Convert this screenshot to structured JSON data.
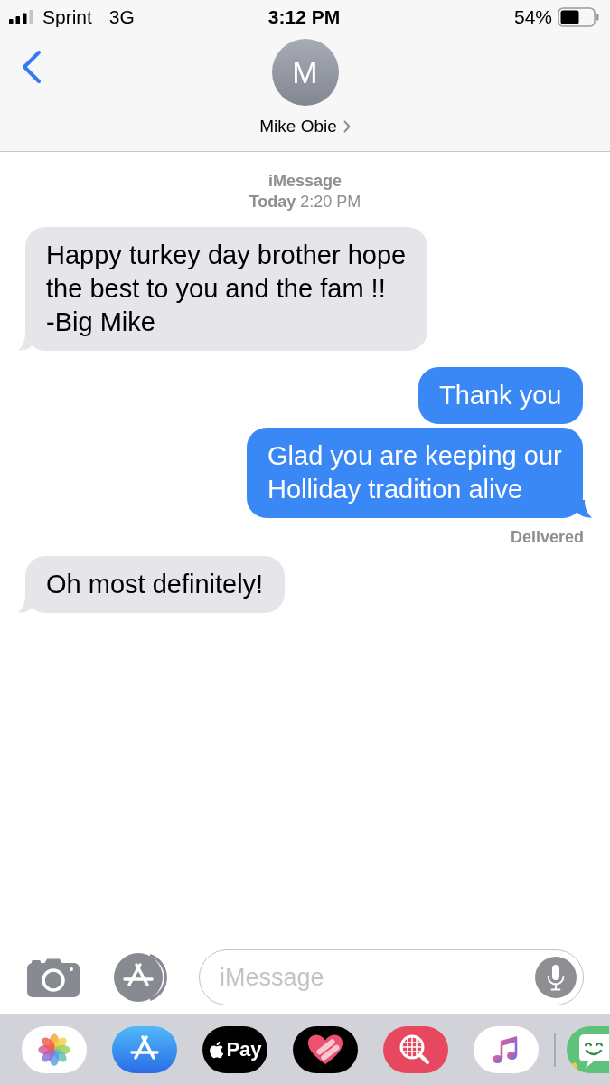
{
  "status_bar": {
    "carrier": "Sprint",
    "network": "3G",
    "time": "3:12 PM",
    "battery": "54%"
  },
  "header": {
    "avatar_initial": "M",
    "contact_name": "Mike Obie"
  },
  "conversation": {
    "service": "iMessage",
    "timestamp": "**Today** 2:20 PM",
    "messages": [
      {
        "kind": "incoming",
        "text": "Happy turkey day brother hope the best to you and the fam !! -Big Mike"
      },
      {
        "kind": "outgoing",
        "text": "Thank you"
      },
      {
        "kind": "outgoing",
        "text": "Glad you are keeping our Holliday tradition alive",
        "receipt": "Delivered"
      },
      {
        "kind": "incoming",
        "text": "Oh most definitely!"
      }
    ]
  },
  "composer": {
    "placeholder": "iMessage"
  },
  "app_drawer": {
    "apps": [
      {
        "kind": "photos"
      },
      {
        "kind": "app-store"
      },
      {
        "kind": "apple-pay",
        "label": "Pay"
      },
      {
        "kind": "digital-touch"
      },
      {
        "kind": "image-search"
      },
      {
        "kind": "music"
      }
    ],
    "more_apps": [
      {
        "kind": "stickers"
      }
    ]
  }
}
